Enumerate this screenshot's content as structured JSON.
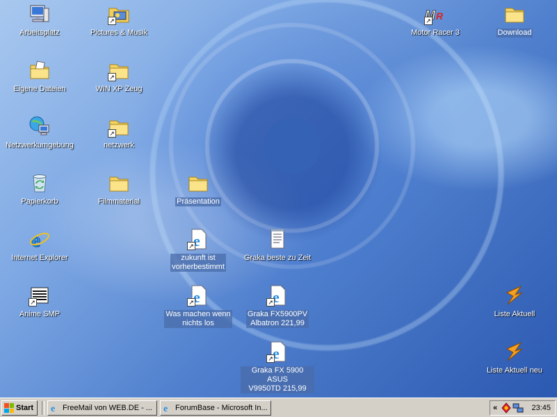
{
  "desktop_icons": [
    {
      "label": "Arbeitsplatz",
      "icon": "computer-icon"
    },
    {
      "label": "Pictures & Musik",
      "icon": "folder-media-shortcut-icon"
    },
    {
      "label": "Motor Racer 3",
      "icon": "motor-racer-icon"
    },
    {
      "label": "Download",
      "icon": "folder-icon"
    },
    {
      "label": "Eigene Dateien",
      "icon": "my-documents-icon"
    },
    {
      "label": "WIN XP Zeug",
      "icon": "folder-shortcut-icon"
    },
    {
      "label": "Netzwerkumgebung",
      "icon": "network-icon"
    },
    {
      "label": "netzwerk",
      "icon": "folder-shortcut-icon"
    },
    {
      "label": "Papierkorb",
      "icon": "recycle-bin-icon"
    },
    {
      "label": "Filmmaterial",
      "icon": "folder-icon"
    },
    {
      "label": "Präsentation",
      "icon": "folder-icon"
    },
    {
      "label": "Internet Explorer",
      "icon": "internet-explorer-icon"
    },
    {
      "label": "zukunft ist\nvorherbestimmt",
      "icon": "ie-page-shortcut-icon"
    },
    {
      "label": "Graka beste zu Zeit",
      "icon": "notepad-icon"
    },
    {
      "label": "Anime SMP",
      "icon": "anime-smp-icon"
    },
    {
      "label": "Was machen wenn\nnichts los",
      "icon": "ie-page-shortcut-icon"
    },
    {
      "label": "Graka FX5900PV\nAlbatron 221,99",
      "icon": "ie-page-shortcut-icon"
    },
    {
      "label": "Liste Aktuell",
      "icon": "winamp-icon"
    },
    {
      "label": "Graka FX 5900 ASUS\nV9950TD 215,99",
      "icon": "ie-page-shortcut-icon"
    },
    {
      "label": "Liste Aktuell neu",
      "icon": "winamp-icon"
    }
  ],
  "taskbar": {
    "start_label": "Start",
    "tasks": [
      {
        "label": "FreeMail von WEB.DE - ...",
        "icon": "ie-icon"
      },
      {
        "label": "ForumBase - Microsoft In...",
        "icon": "ie-icon"
      }
    ],
    "tray": {
      "chevron": "«",
      "icons": [
        "security-icon",
        "network-tray-icon"
      ],
      "clock": "23:45"
    }
  },
  "colors": {
    "desktop_blue": "#4f7fcd",
    "taskbar_gray": "#d4d0c8",
    "label_highlight": "#4a6caa"
  }
}
